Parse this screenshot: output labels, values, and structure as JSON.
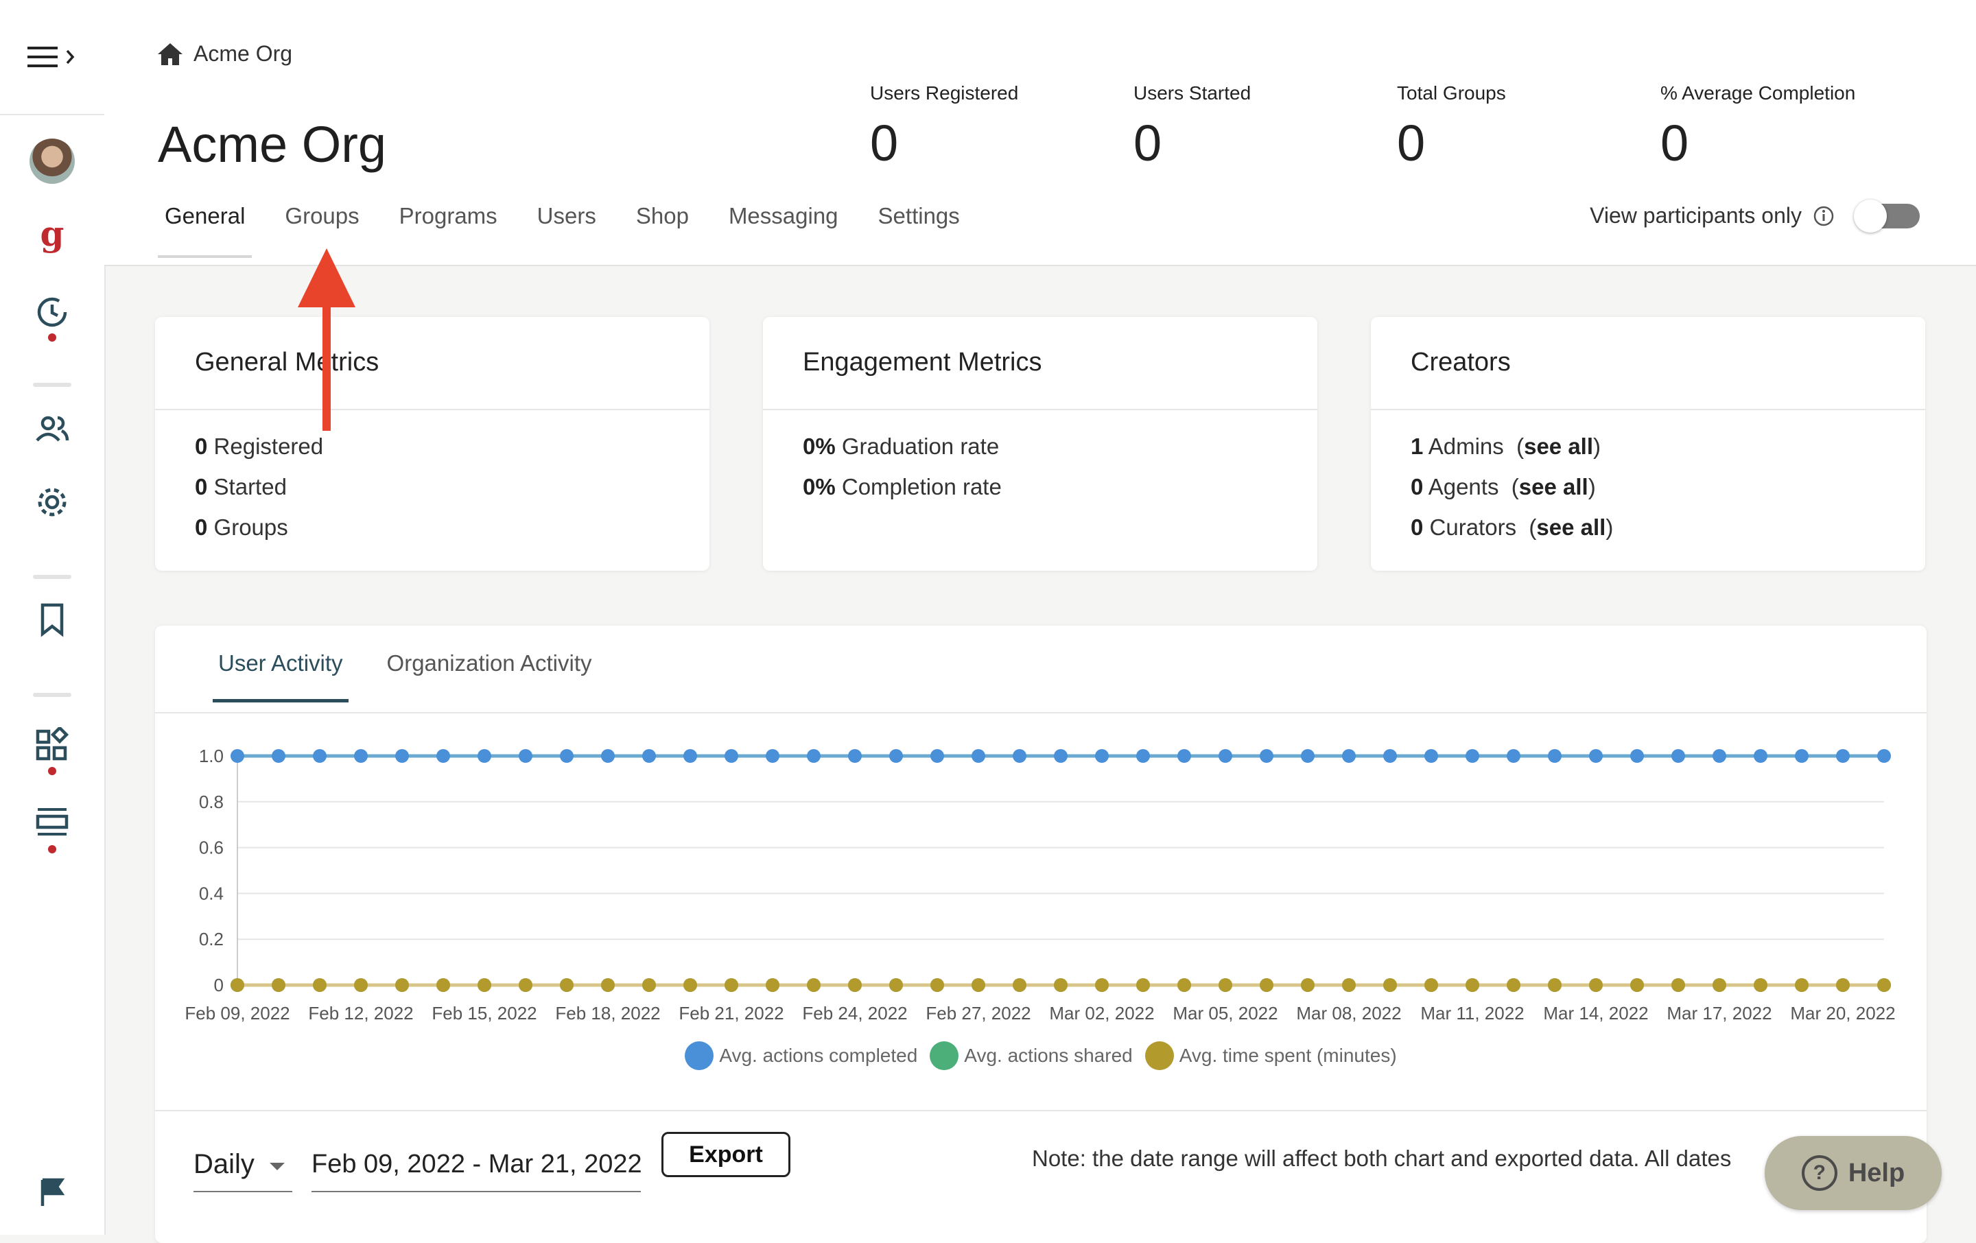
{
  "breadcrumb": {
    "label": "Acme Org"
  },
  "page": {
    "title": "Acme Org"
  },
  "stats": [
    {
      "label": "Users Registered",
      "value": "0"
    },
    {
      "label": "Users Started",
      "value": "0"
    },
    {
      "label": "Total Groups",
      "value": "0"
    },
    {
      "label": "% Average Completion",
      "value": "0"
    }
  ],
  "tabs": [
    "General",
    "Groups",
    "Programs",
    "Users",
    "Shop",
    "Messaging",
    "Settings"
  ],
  "active_tab": "General",
  "view_participants": {
    "label": "View participants only",
    "enabled": false
  },
  "cards": {
    "general": {
      "title": "General Metrics",
      "rows": [
        {
          "value": "0",
          "label": "Registered"
        },
        {
          "value": "0",
          "label": "Started"
        },
        {
          "value": "0",
          "label": "Groups"
        }
      ]
    },
    "engagement": {
      "title": "Engagement Metrics",
      "rows": [
        {
          "value": "0%",
          "label": "Graduation rate"
        },
        {
          "value": "0%",
          "label": "Completion rate"
        }
      ]
    },
    "creators": {
      "title": "Creators",
      "rows": [
        {
          "value": "1",
          "label": "Admins",
          "link": "see all"
        },
        {
          "value": "0",
          "label": "Agents",
          "link": "see all"
        },
        {
          "value": "0",
          "label": "Curators",
          "link": "see all"
        }
      ]
    }
  },
  "activity": {
    "tabs": [
      "User Activity",
      "Organization Activity"
    ],
    "active_tab": "User Activity"
  },
  "chart_data": {
    "type": "line",
    "x_ticks": [
      "Feb 09, 2022",
      "Feb 12, 2022",
      "Feb 15, 2022",
      "Feb 18, 2022",
      "Feb 21, 2022",
      "Feb 24, 2022",
      "Feb 27, 2022",
      "Mar 02, 2022",
      "Mar 05, 2022",
      "Mar 08, 2022",
      "Mar 11, 2022",
      "Mar 14, 2022",
      "Mar 17, 2022",
      "Mar 20, 2022"
    ],
    "x_start": "2022-02-09",
    "x_end": "2022-03-21",
    "y_ticks": [
      "0",
      "0.2",
      "0.4",
      "0.6",
      "0.8",
      "1.0"
    ],
    "ylim": [
      0,
      1
    ],
    "grid": true,
    "legend_position": "bottom",
    "series": [
      {
        "name": "Avg. actions completed",
        "color": "#4a90d9",
        "line_color": "#6aaad0",
        "value": 1
      },
      {
        "name": "Avg. actions shared",
        "color": "#4caf7a",
        "value": 0
      },
      {
        "name": "Avg. time spent (minutes)",
        "color": "#b39a2c",
        "line_color": "#d9c58a",
        "value": 0
      }
    ]
  },
  "controls": {
    "interval": "Daily",
    "date_range": "Feb 09, 2022 - Mar 21, 2022",
    "export_label": "Export",
    "note": "Note: the date range will affect both chart and exported data. All dates"
  },
  "help": {
    "label": "Help"
  },
  "colors": {
    "sidebar_icon": "#2b4d5c",
    "accent_red": "#c0292e",
    "annotation_arrow": "#e8432b"
  }
}
